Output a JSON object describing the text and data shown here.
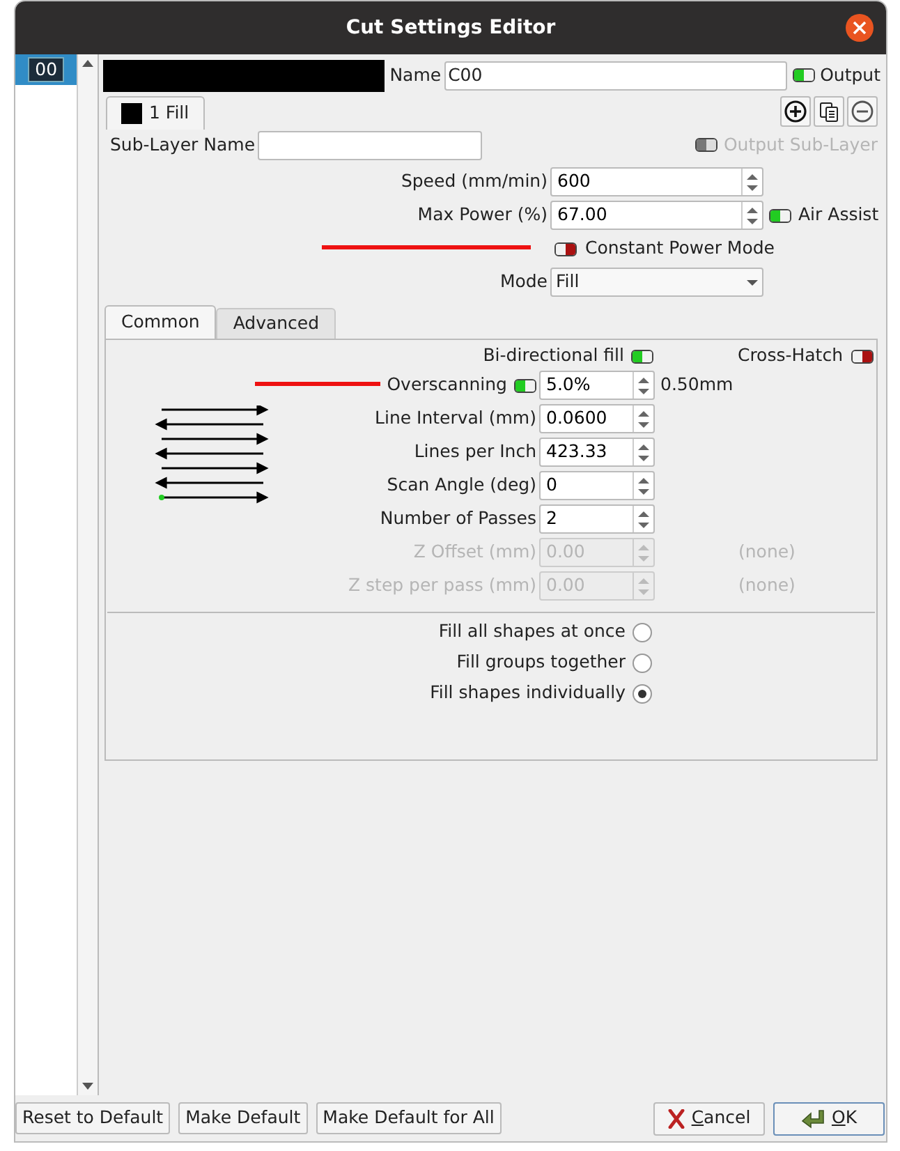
{
  "window": {
    "title": "Cut Settings Editor"
  },
  "layers": [
    {
      "label": "00",
      "selected": true
    }
  ],
  "layer": {
    "color": "#000000",
    "name_label": "Name",
    "name": "C00",
    "output": {
      "label": "Output",
      "on": true
    }
  },
  "sub_tabs": [
    {
      "label": "1 Fill",
      "color": "#000000",
      "selected": true
    }
  ],
  "sub_layer": {
    "label": "Sub-Layer Name",
    "output": {
      "label": "Output Sub-Layer",
      "disabled": true
    }
  },
  "settings": [
    {
      "kind": "spin",
      "label": "Speed (mm/min)",
      "value": "600"
    },
    {
      "kind": "spin",
      "label": "Max Power (%)",
      "value": "67.00",
      "toggle": {
        "label": "Air Assist",
        "on": true
      }
    },
    {
      "kind": "toggle",
      "label": "Constant Power Mode",
      "on": false
    },
    {
      "kind": "select",
      "label": "Mode",
      "value": "Fill"
    }
  ],
  "tabs": [
    {
      "label": "Common",
      "selected": true
    },
    {
      "label": "Advanced",
      "selected": false
    }
  ],
  "bidirectional": {
    "label": "Bi-directional fill",
    "on": true
  },
  "cross_hatch": {
    "label": "Cross-Hatch",
    "on": false
  },
  "fill_settings": [
    {
      "label": "Overscanning",
      "toggle_on": true,
      "value": "5.0%",
      "note": "0.50mm",
      "disabled": false
    },
    {
      "label": "Line Interval (mm)",
      "value": "0.0600",
      "disabled": false
    },
    {
      "label": "Lines per Inch",
      "value": "423.33",
      "disabled": false
    },
    {
      "label": "Scan Angle (deg)",
      "value": "0",
      "disabled": false
    },
    {
      "label": "Number of Passes",
      "value": "2",
      "disabled": false
    },
    {
      "label": "Z Offset (mm)",
      "value": "0.00",
      "note": "(none)",
      "disabled": true
    },
    {
      "label": "Z step per pass (mm)",
      "value": "0.00",
      "note": "(none)",
      "disabled": true
    }
  ],
  "fill_order": [
    {
      "label": "Fill all shapes at once",
      "selected": false
    },
    {
      "label": "Fill groups together",
      "selected": false
    },
    {
      "label": "Fill shapes individually",
      "selected": true
    }
  ],
  "footer_buttons": [
    {
      "label": "Reset to Default"
    },
    {
      "label": "Make Default"
    },
    {
      "label": "Make Default for All"
    }
  ],
  "cancel": {
    "label": "Cancel"
  },
  "ok": {
    "label": "OK"
  }
}
